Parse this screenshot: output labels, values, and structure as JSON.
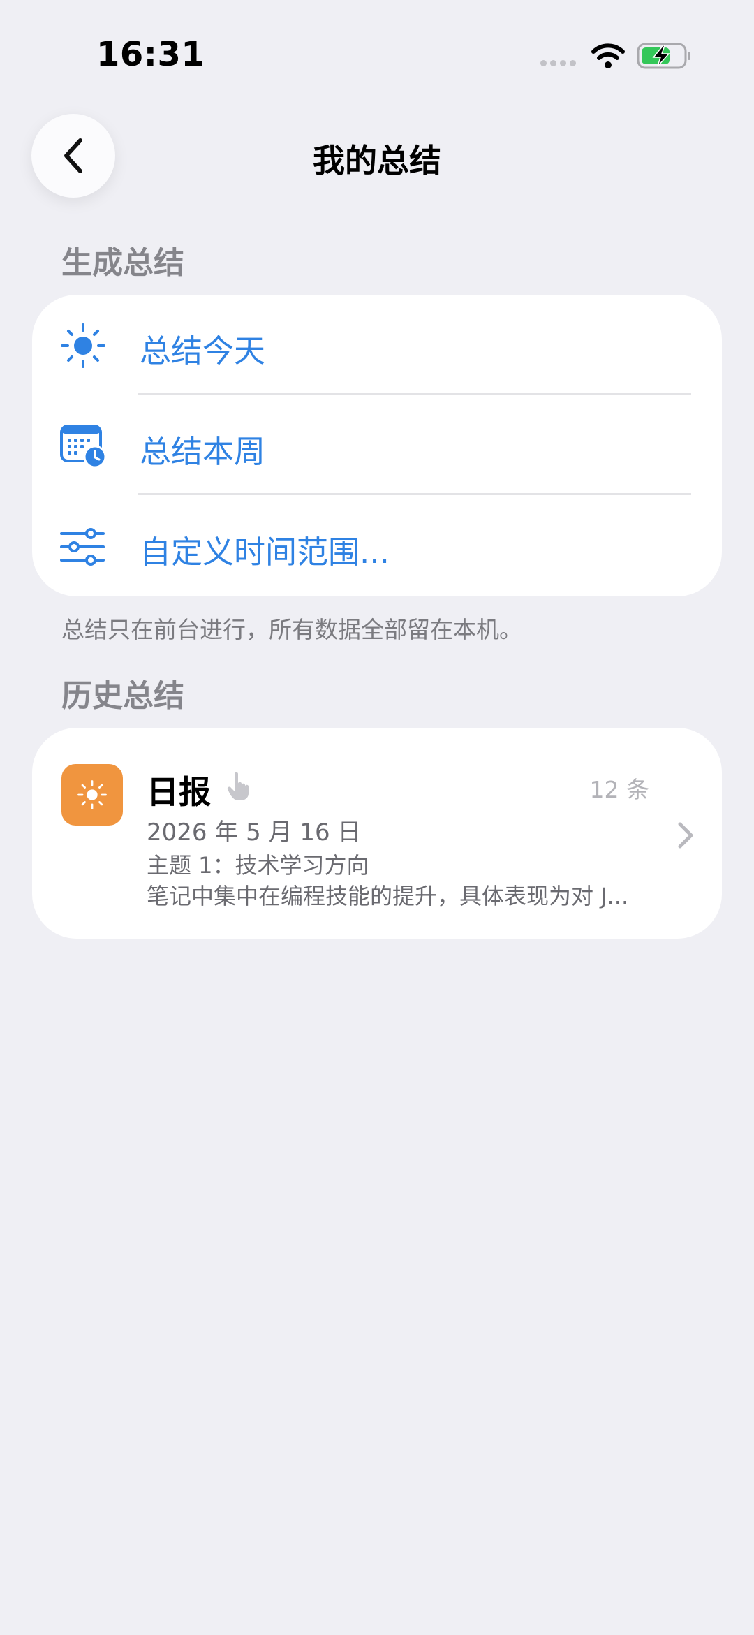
{
  "status_bar": {
    "time": "16:31"
  },
  "nav": {
    "title": "我的总结",
    "back_icon": "chevron-left-icon"
  },
  "generate": {
    "header": "生成总结",
    "items": [
      {
        "label": "总结今天",
        "icon": "sun-icon"
      },
      {
        "label": "总结本周",
        "icon": "calendar-clock-icon"
      },
      {
        "label": "自定义时间范围...",
        "icon": "sliders-icon"
      }
    ],
    "footnote": "总结只在前台进行，所有数据全部留在本机。"
  },
  "history": {
    "header": "历史总结",
    "items": [
      {
        "title": "日报",
        "count": "12 条",
        "date": "2026 年 5 月 16 日",
        "topic": "主题 1：技术学习方向",
        "preview": "笔记中集中在编程技能的提升，具体表现为对 J...",
        "icon": "sun-icon"
      }
    ]
  },
  "colors": {
    "background": "#efeff4",
    "accent_blue": "#2f82e3",
    "daily_orange": "#f0953f",
    "battery_green": "#34c759"
  }
}
